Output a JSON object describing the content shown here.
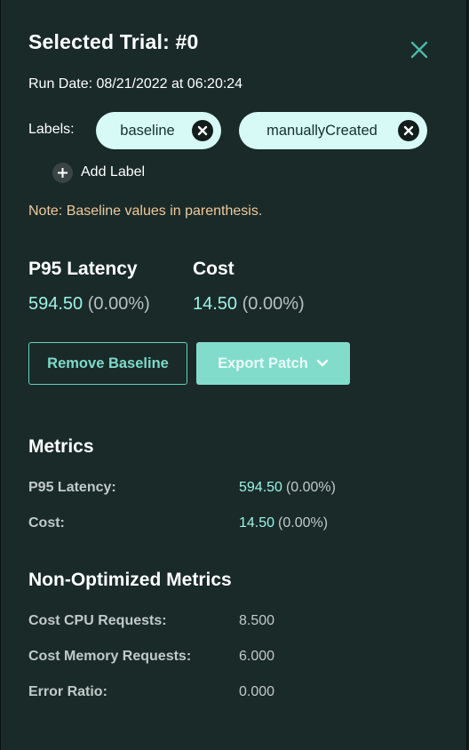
{
  "header": {
    "title": "Selected Trial: #0",
    "run_date": "Run Date: 08/21/2022 at 06:20:24"
  },
  "labels": {
    "caption": "Labels:",
    "chips": [
      "baseline",
      "manuallyCreated"
    ],
    "add_label": "Add Label"
  },
  "note": "Note: Baseline values in parenthesis.",
  "summary": {
    "metrics": [
      {
        "name": "P95 Latency",
        "value": "594.50",
        "pct": "(0.00%)"
      },
      {
        "name": "Cost",
        "value": "14.50",
        "pct": "(0.00%)"
      }
    ]
  },
  "actions": {
    "remove_baseline": "Remove Baseline",
    "export_patch": "Export Patch"
  },
  "metrics": {
    "title": "Metrics",
    "rows": [
      {
        "label": "P95 Latency:",
        "value": "594.50",
        "pct": "(0.00%)"
      },
      {
        "label": "Cost:",
        "value": "14.50",
        "pct": "(0.00%)"
      }
    ]
  },
  "non_optimized": {
    "title": "Non-Optimized Metrics",
    "rows": [
      {
        "label": "Cost CPU Requests:",
        "value": "8.500"
      },
      {
        "label": "Cost Memory Requests:",
        "value": "6.000"
      },
      {
        "label": "Error Ratio:",
        "value": "0.000"
      }
    ]
  },
  "colors": {
    "panel_bg": "#192a29",
    "accent": "#82dccc",
    "value_text": "#9ef2e6",
    "note_text": "#f0c99a",
    "chip_bg": "#d8faf6"
  },
  "icons": {
    "close": "close-icon",
    "chip_remove": "remove-circle-icon",
    "add": "plus-circle-icon",
    "dropdown": "chevron-down-icon"
  }
}
